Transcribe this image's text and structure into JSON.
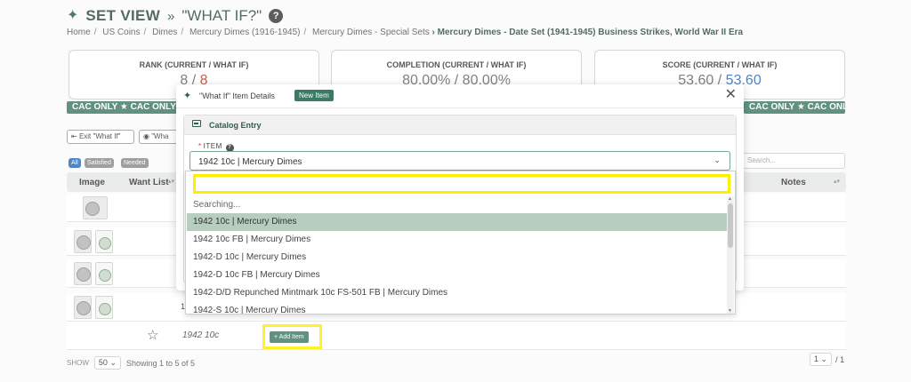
{
  "header": {
    "title": "SET VIEW",
    "subtitle": "\"WHAT IF?\"",
    "help": "?"
  },
  "breadcrumb": {
    "items": [
      "Home",
      "US Coins",
      "Dimes",
      "Mercury Dimes (1916-1945)",
      "Mercury Dimes - Special Sets"
    ],
    "current": "Mercury Dimes - Date Set (1941-1945) Business Strikes, World War II Era"
  },
  "stats": [
    {
      "label": "RANK (CURRENT / WHAT IF)",
      "current": "8",
      "whatif": "8"
    },
    {
      "label": "COMPLETION (CURRENT / WHAT IF)",
      "current": "80.00%",
      "whatif": "80.00%"
    },
    {
      "label": "SCORE (CURRENT / WHAT IF)",
      "current": "53.60",
      "whatif": "53.60"
    }
  ],
  "cac_banner": {
    "left": "CAC ONLY  ★  CAC ONLY",
    "right": "CAC ONLY  ★  CAC ONLY  ★  CAC ON"
  },
  "toolbar": {
    "exit_label": "Exit \"What If\"",
    "whatif_label": "\"Wha"
  },
  "filters": [
    "All",
    "Satisfied",
    "Needed"
  ],
  "search_placeholder": "Search...",
  "table": {
    "columns": [
      "Image",
      "Want List",
      "Notes"
    ],
    "rows": [
      {
        "images": 1
      },
      {
        "images": 2
      },
      {
        "images": 2
      },
      {
        "images": 2,
        "partial": "1"
      },
      {
        "images": 0,
        "name": "1942 10c"
      }
    ]
  },
  "add_item_label": "Add Item",
  "footer": {
    "show_label": "SHOW",
    "page_size": "50",
    "showing": "Showing 1 to 5 of 5",
    "page": "1",
    "total_pages": "/ 1"
  },
  "modal": {
    "title": "\"What If\" Item Details",
    "badge": "New Item",
    "section_title": "Catalog Entry",
    "item_label": "ITEM",
    "selected_value": "1942 10c | Mercury Dimes",
    "searching_text": "Searching...",
    "options": [
      "1942 10c | Mercury Dimes",
      "1942 10c FB | Mercury Dimes",
      "1942-D 10c | Mercury Dimes",
      "1942-D 10c FB | Mercury Dimes",
      "1942-D/D Repunched Mintmark 10c FS-501 FB | Mercury Dimes",
      "1942-S 10c | Mercury Dimes"
    ]
  },
  "colors": {
    "brand": "#3d7a63",
    "highlight": "#ffee00",
    "active_option": "#b6cdc0"
  }
}
